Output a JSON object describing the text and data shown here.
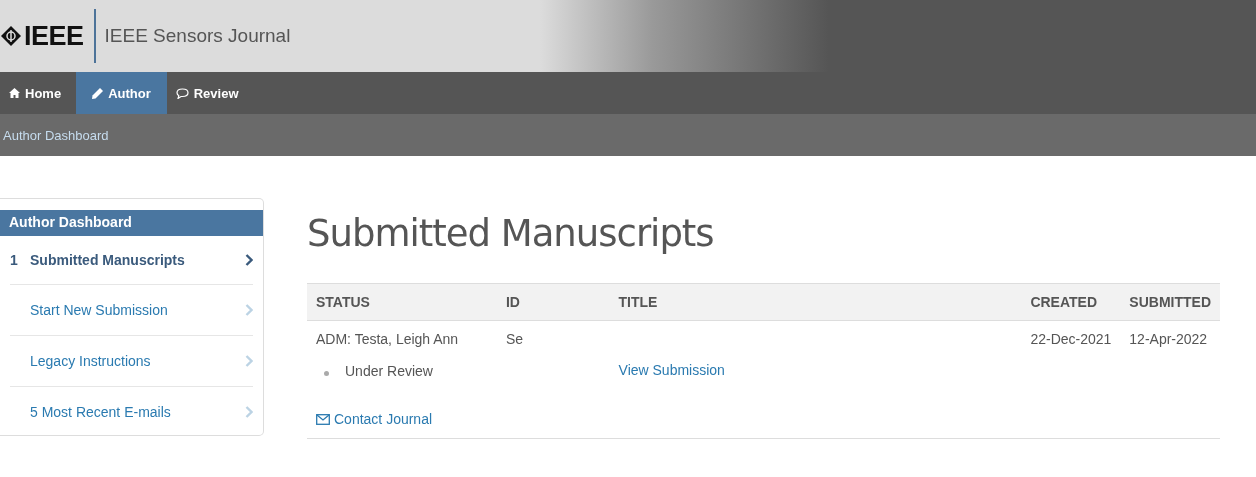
{
  "header": {
    "brand": "IEEE",
    "journal": "IEEE Sensors Journal"
  },
  "nav": [
    {
      "label": "Home",
      "kind": "home",
      "selected": false
    },
    {
      "label": "Author",
      "kind": "pencil",
      "selected": true
    },
    {
      "label": "Review",
      "kind": "comment",
      "selected": false
    }
  ],
  "breadcrumb": "Author Dashboard",
  "sidebar": {
    "title": "Author Dashboard",
    "items": [
      {
        "label": "Submitted Manuscripts",
        "count": "1",
        "selected": true
      },
      {
        "label": "Start New Submission",
        "selected": false
      },
      {
        "label": "Legacy Instructions",
        "selected": false
      },
      {
        "label": "5 Most Recent E-mails",
        "selected": false
      }
    ]
  },
  "page_title": "Submitted Manuscripts",
  "table": {
    "columns": [
      "STATUS",
      "ID",
      "TITLE",
      "CREATED",
      "SUBMITTED"
    ],
    "rows": [
      {
        "status": "ADM: Testa, Leigh Ann",
        "id": "Se",
        "created": "22-Dec-2021",
        "submitted": "12-Apr-2022",
        "view_link": "View Submission",
        "status_items": [
          "Under Review"
        ],
        "contact_link": "Contact Journal"
      }
    ]
  }
}
